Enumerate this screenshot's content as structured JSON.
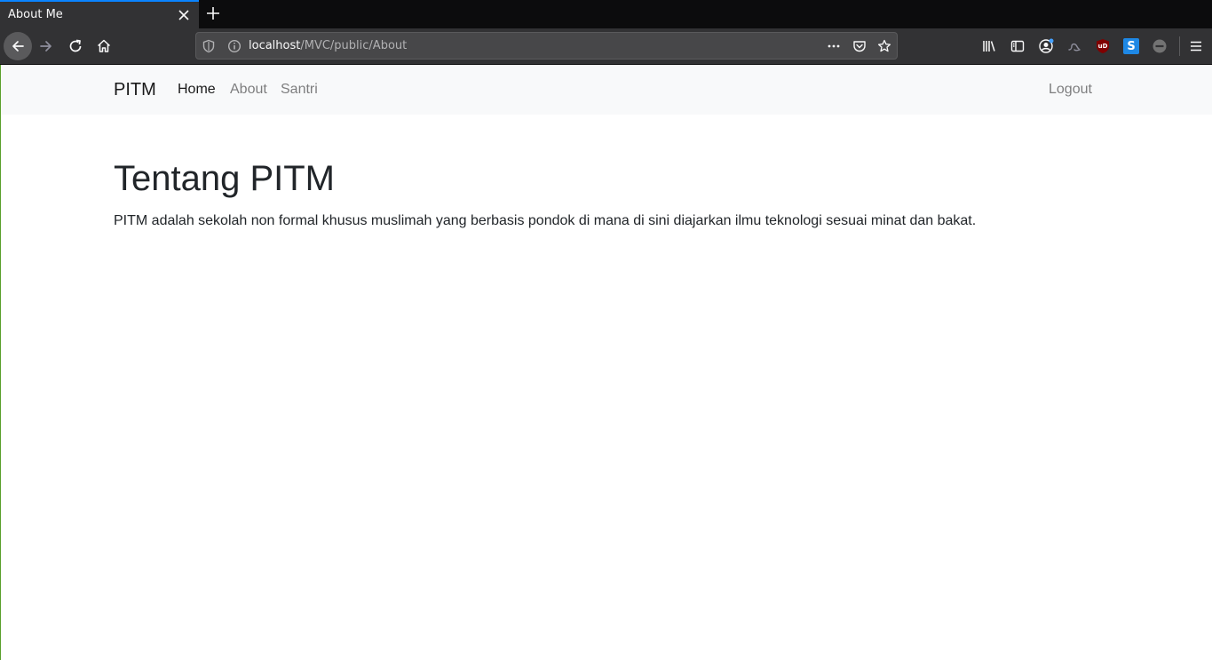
{
  "browser": {
    "tab": {
      "title": "About Me"
    },
    "url": {
      "host": "localhost",
      "path": "/MVC/public/About"
    },
    "extensions": {
      "ublock_label": "uD",
      "s_label": "S"
    },
    "colors": {
      "accent": "#0a84ff",
      "toolbar": "#323234",
      "tabstrip": "#0c0c0d"
    },
    "icons": [
      "back-icon",
      "forward-icon",
      "reload-icon",
      "home-icon",
      "shield-icon",
      "info-icon",
      "more-icon",
      "pocket-icon",
      "star-icon",
      "library-icon",
      "sidebar-icon",
      "account-icon",
      "extension-icon",
      "ublock-icon",
      "s-extension-icon",
      "blocked-icon",
      "menu-icon"
    ]
  },
  "navbar": {
    "brand": "PITM",
    "links": [
      {
        "label": "Home",
        "active": true
      },
      {
        "label": "About",
        "active": false
      },
      {
        "label": "Santri",
        "active": false
      }
    ],
    "logout": "Logout"
  },
  "main": {
    "title": "Tentang PITM",
    "text": "PITM adalah sekolah non formal khusus muslimah yang berbasis pondok di mana di sini diajarkan ilmu teknologi sesuai minat dan bakat."
  }
}
